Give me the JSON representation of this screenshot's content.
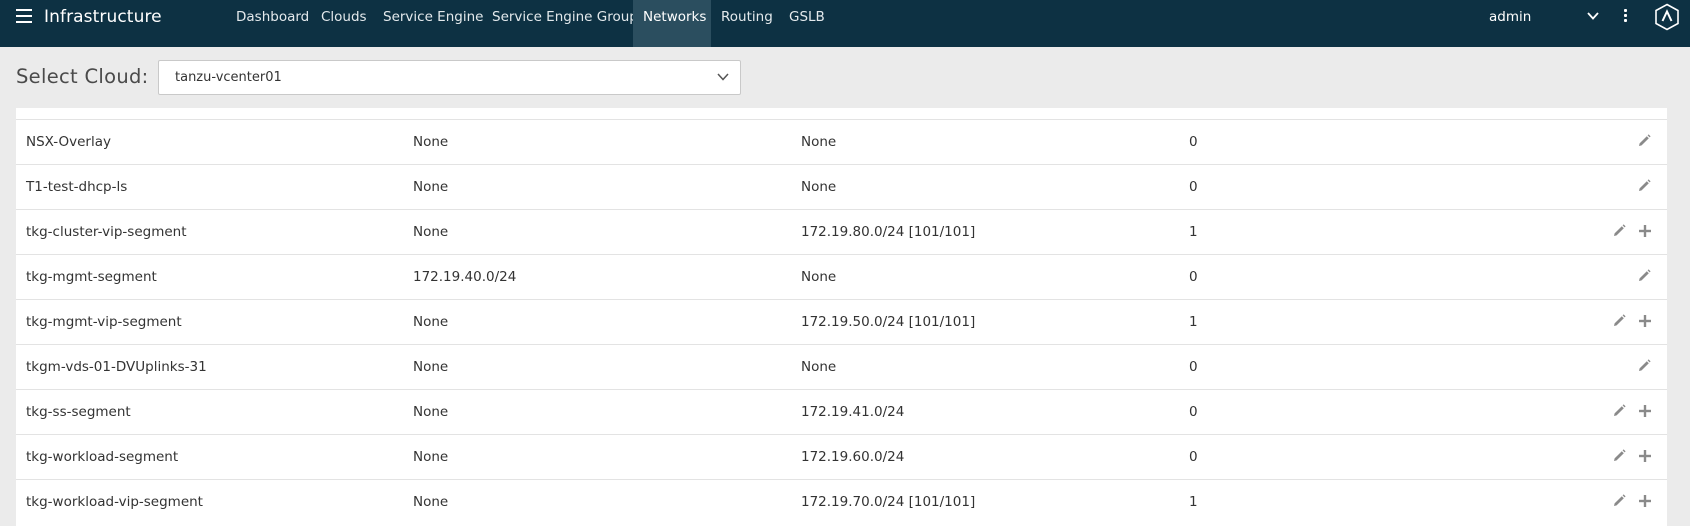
{
  "header": {
    "title": "Infrastructure",
    "tabs": [
      {
        "label": "Dashboard",
        "active": false
      },
      {
        "label": "Clouds",
        "active": false
      },
      {
        "label": "Service Engine",
        "active": false
      },
      {
        "label": "Service Engine Group",
        "active": false
      },
      {
        "label": "Networks",
        "active": true
      },
      {
        "label": "Routing",
        "active": false
      },
      {
        "label": "GSLB",
        "active": false
      }
    ],
    "user": "admin",
    "icons": [
      "menu-icon",
      "chevron-down-icon",
      "kebab-menu-icon",
      "app-logo-icon"
    ]
  },
  "cloud_selector": {
    "label": "Select Cloud:",
    "value": "tanzu-vcenter01"
  },
  "networks": {
    "rows": [
      {
        "name": "NSX-Overlay",
        "discovered_subnets": "None",
        "configured_subnets": "None",
        "static_ip_pools": "0",
        "actions": [
          "edit"
        ]
      },
      {
        "name": "T1-test-dhcp-ls",
        "discovered_subnets": "None",
        "configured_subnets": "None",
        "static_ip_pools": "0",
        "actions": [
          "edit"
        ]
      },
      {
        "name": "tkg-cluster-vip-segment",
        "discovered_subnets": "None",
        "configured_subnets": "172.19.80.0/24 [101/101]",
        "static_ip_pools": "1",
        "actions": [
          "edit",
          "add"
        ]
      },
      {
        "name": "tkg-mgmt-segment",
        "discovered_subnets": "172.19.40.0/24",
        "configured_subnets": "None",
        "static_ip_pools": "0",
        "actions": [
          "edit"
        ]
      },
      {
        "name": "tkg-mgmt-vip-segment",
        "discovered_subnets": "None",
        "configured_subnets": "172.19.50.0/24 [101/101]",
        "static_ip_pools": "1",
        "actions": [
          "edit",
          "add"
        ]
      },
      {
        "name": "tkgm-vds-01-DVUplinks-31",
        "discovered_subnets": "None",
        "configured_subnets": "None",
        "static_ip_pools": "0",
        "actions": [
          "edit"
        ]
      },
      {
        "name": "tkg-ss-segment",
        "discovered_subnets": "None",
        "configured_subnets": "172.19.41.0/24",
        "static_ip_pools": "0",
        "actions": [
          "edit",
          "add"
        ]
      },
      {
        "name": "tkg-workload-segment",
        "discovered_subnets": "None",
        "configured_subnets": "172.19.60.0/24",
        "static_ip_pools": "0",
        "actions": [
          "edit",
          "add"
        ]
      },
      {
        "name": "tkg-workload-vip-segment",
        "discovered_subnets": "None",
        "configured_subnets": "172.19.70.0/24 [101/101]",
        "static_ip_pools": "1",
        "actions": [
          "edit",
          "add"
        ]
      }
    ]
  },
  "colors": {
    "nav_bg": "#0d3143",
    "nav_active": "#2b4e5f",
    "page_bg": "#ebebeb",
    "icon_gray": "#8a8a8a"
  }
}
